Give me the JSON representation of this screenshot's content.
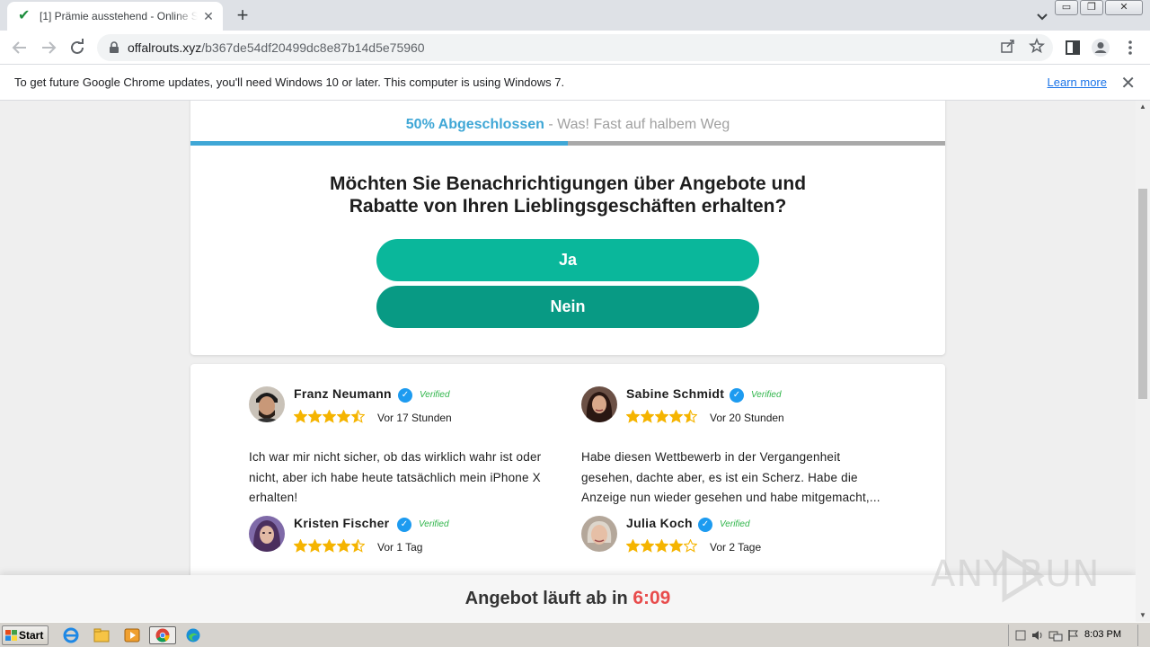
{
  "browser": {
    "tab_title": "[1] Prämie ausstehend - Online Survey",
    "new_tab": "+",
    "url_host": "offalrouts.xyz",
    "url_path": "/b367de54df20499dc8e87b14d5e75960"
  },
  "infobar": {
    "message": "To get future Google Chrome updates, you'll need Windows 10 or later. This computer is using Windows 7.",
    "learn_more": "Learn more"
  },
  "survey": {
    "progress_label": "50% Abgeschlossen",
    "progress_sub": " - Was! Fast auf halbem Weg",
    "progress_fraction": 0.5,
    "question_line1": "Möchten Sie Benachrichtigungen über Angebote und",
    "question_line2": "Rabatte von Ihren Lieblingsgeschäften erhalten?",
    "yes_label": "Ja",
    "no_label": "Nein"
  },
  "reviews": [
    {
      "name": "Franz Neumann",
      "verified": "Verified",
      "rating": 4.5,
      "time": "Vor 17 Stunden",
      "text": "Ich war mir nicht sicher, ob das wirklich wahr ist oder nicht, aber ich habe heute tatsächlich mein iPhone X erhalten!"
    },
    {
      "name": "Sabine Schmidt",
      "verified": "Verified",
      "rating": 4.5,
      "time": "Vor 20 Stunden",
      "text": "Habe diesen Wettbewerb in der Vergangenheit gesehen, dachte aber, es ist ein Scherz. Habe die Anzeige nun wieder gesehen und habe mitgemacht,..."
    },
    {
      "name": "Kristen Fischer",
      "verified": "Verified",
      "rating": 4.5,
      "time": "Vor 1 Tag",
      "text": ""
    },
    {
      "name": "Julia Koch",
      "verified": "Verified",
      "rating": 4,
      "time": "Vor 2 Tage",
      "text": ""
    }
  ],
  "timer": {
    "label": "Angebot läuft ab in ",
    "time": "6:09"
  },
  "watermark": "ANY RUN",
  "taskbar": {
    "start": "Start",
    "clock": "8:03 PM"
  },
  "colors": {
    "progress": "#3fa7d6",
    "yes": "#0ab79b",
    "no": "#089a84",
    "star": "#f5b400",
    "verified": "#2fb54a",
    "timer": "#e84c4c"
  }
}
